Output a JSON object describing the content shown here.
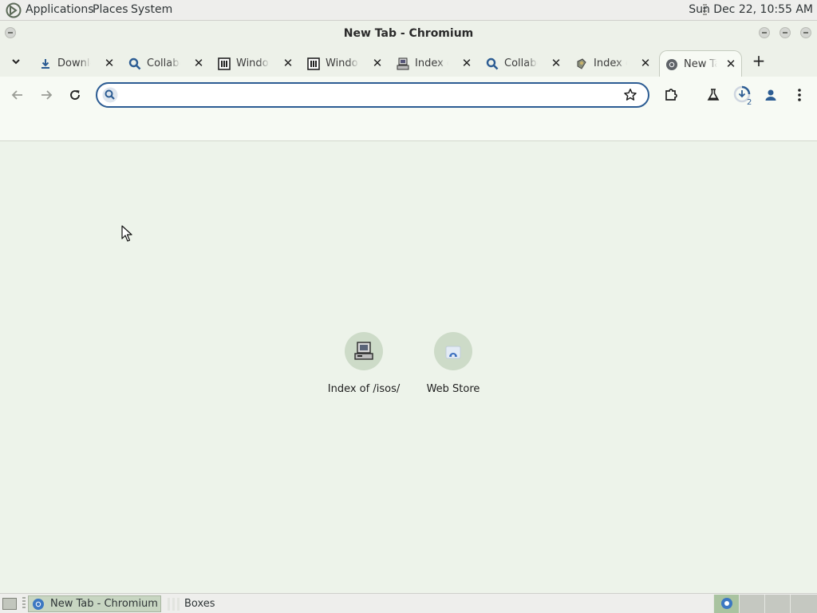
{
  "top_panel": {
    "menus": [
      "Applications",
      "Places",
      "System"
    ],
    "clock": "Sun Dec 22, 10:55 AM"
  },
  "window": {
    "title": "New Tab - Chromium"
  },
  "tabs": [
    {
      "label": "Downloads",
      "icon": "download-icon"
    },
    {
      "label": "Collabora",
      "icon": "search-icon"
    },
    {
      "label": "Windows",
      "icon": "library-icon"
    },
    {
      "label": "Windows",
      "icon": "library-icon"
    },
    {
      "label": "Index of",
      "icon": "computer-icon"
    },
    {
      "label": "Collabora",
      "icon": "search-icon"
    },
    {
      "label": "Index of",
      "icon": "file-icon"
    },
    {
      "label": "New Tab",
      "icon": "chromium-icon",
      "active": true
    }
  ],
  "toolbar": {
    "omnibox_value": "",
    "download_count": "2"
  },
  "shortcuts": [
    {
      "label": "Index of /isos/",
      "icon": "computer-icon"
    },
    {
      "label": "Web Store",
      "icon": "web-store-icon"
    }
  ],
  "taskbar": {
    "items": [
      {
        "label": "New Tab - Chromium",
        "active": true
      },
      {
        "label": "Boxes",
        "active": false
      }
    ]
  },
  "colors": {
    "accent": "#2c5c93",
    "page_background": "#edf3ea",
    "shortcut_circle": "#cddbc8"
  }
}
